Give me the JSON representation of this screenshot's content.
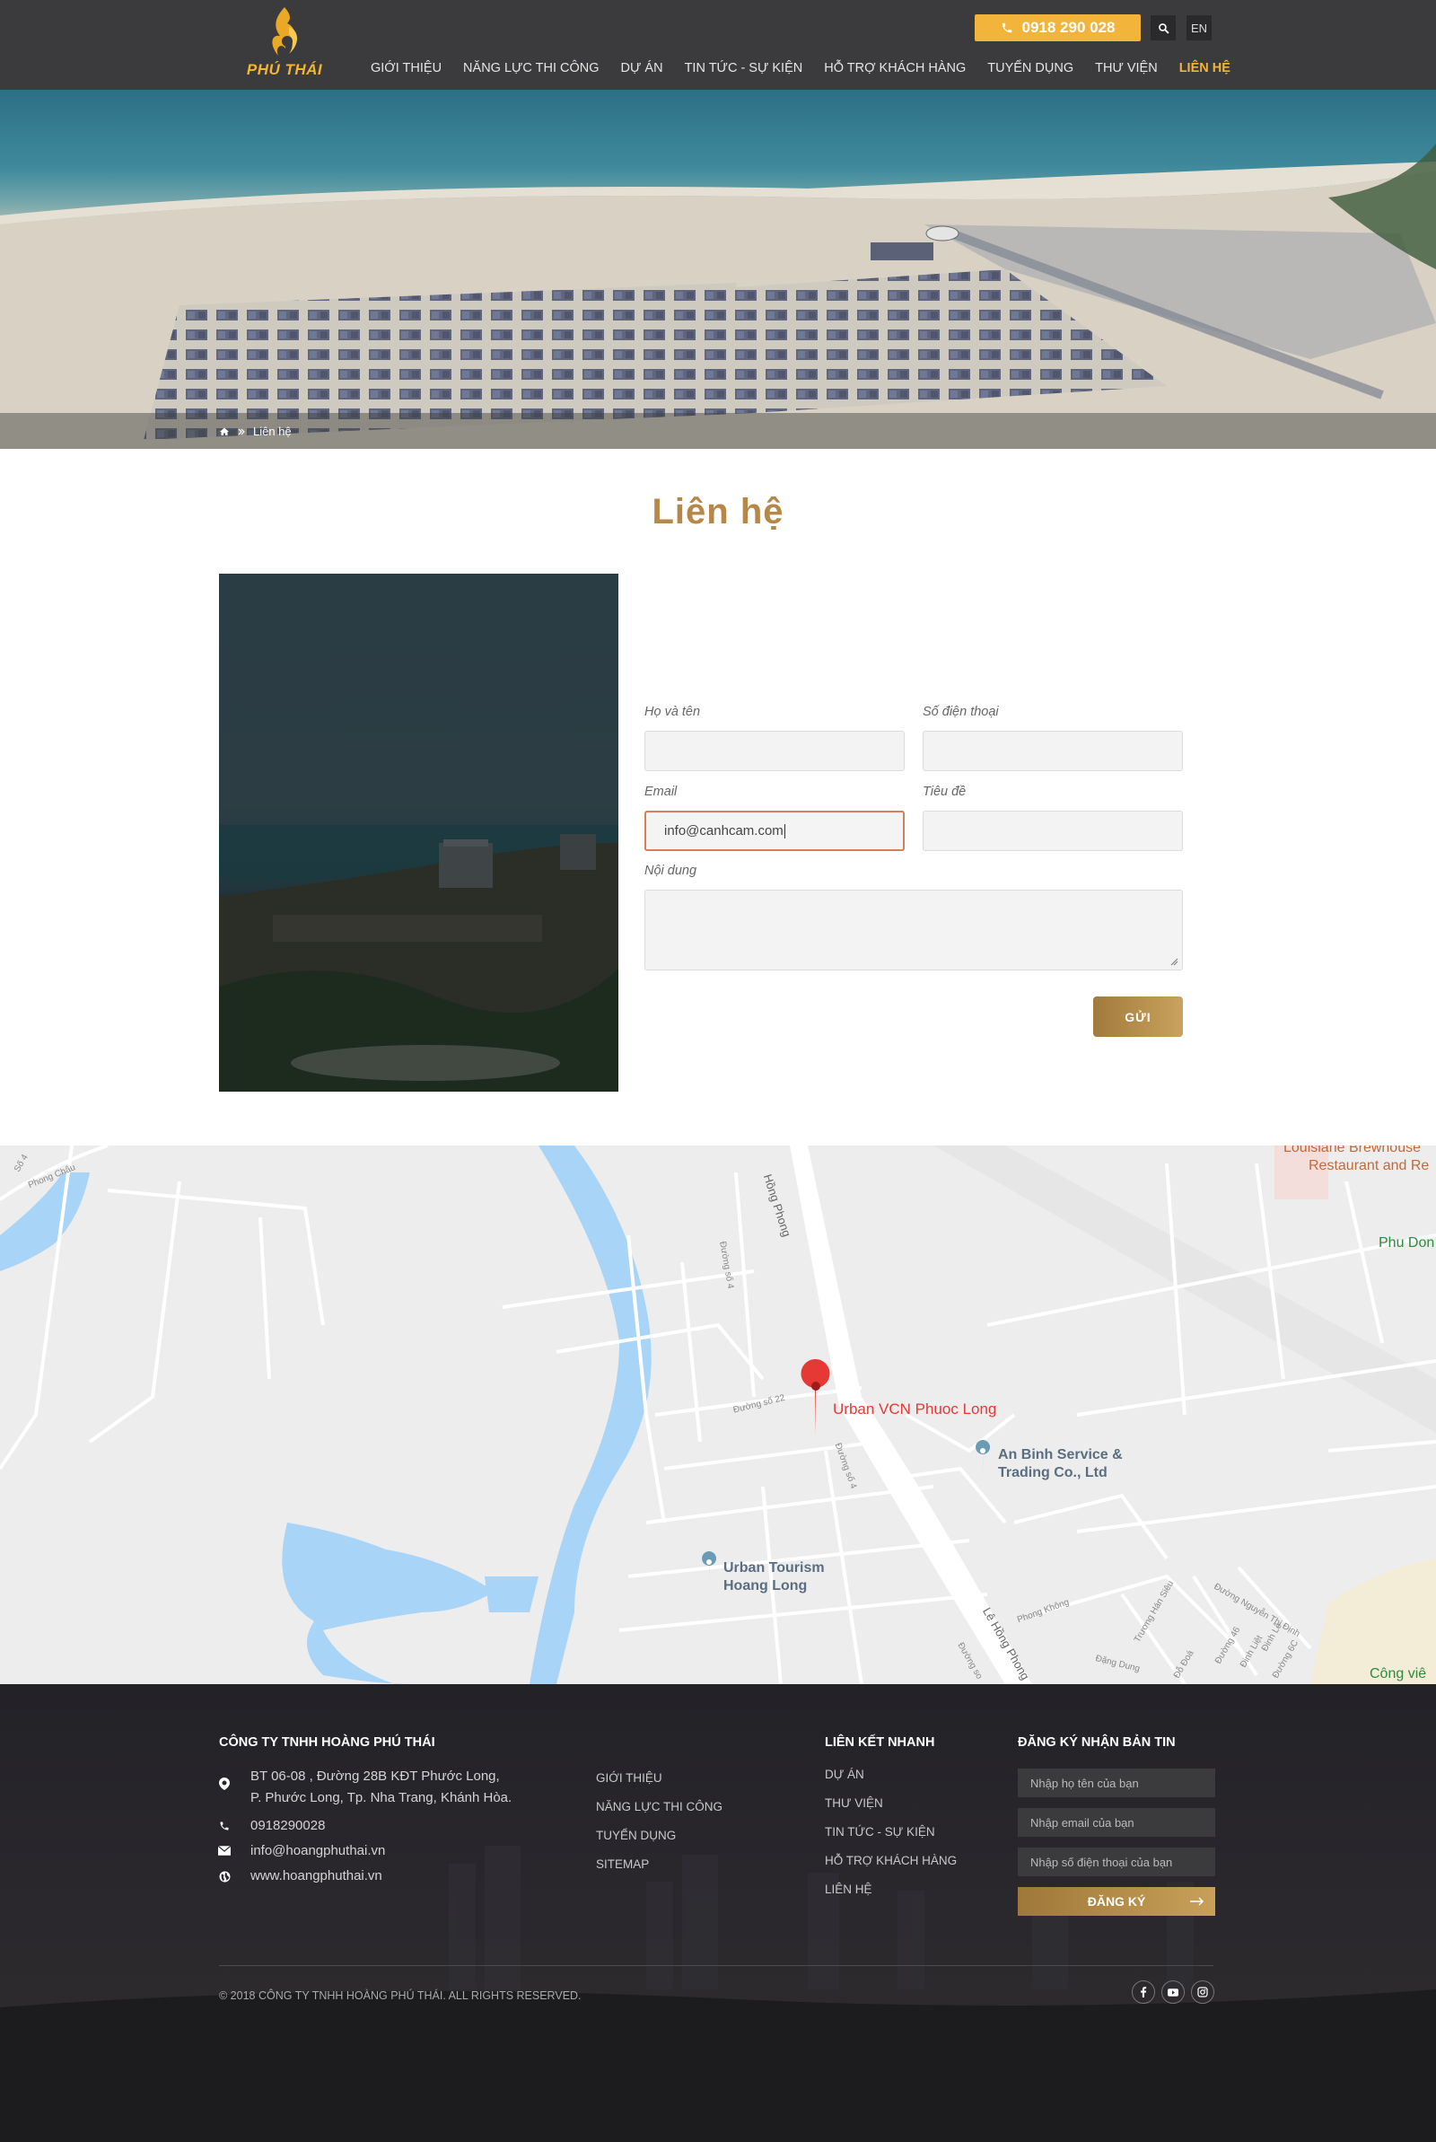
{
  "header": {
    "logo_text": "PHÚ THÁI",
    "phone": "0918 290 028",
    "lang": "EN",
    "nav": [
      {
        "label": "GIỚI THIỆU"
      },
      {
        "label": "NĂNG LỰC THI CÔNG"
      },
      {
        "label": "DỰ ÁN"
      },
      {
        "label": "TIN TỨC - SỰ KIỆN"
      },
      {
        "label": "HỖ TRỢ KHÁCH HÀNG"
      },
      {
        "label": "TUYỂN DỤNG"
      },
      {
        "label": "THƯ VIỆN"
      },
      {
        "label": "LIÊN HỆ"
      }
    ],
    "accent_color": "#f2b43b"
  },
  "breadcrumb": {
    "current": "Liên hệ"
  },
  "page": {
    "title": "Liên hệ",
    "title_color": "#b5884a"
  },
  "form": {
    "name_label": "Họ và tên",
    "phone_label": "Số điện thoại",
    "email_label": "Email",
    "email_value": "info@canhcam.com",
    "subject_label": "Tiêu đề",
    "content_label": "Nội dung",
    "submit_label": "GỬI"
  },
  "map": {
    "places": {
      "main": "Urban VCN Phuoc Long",
      "an_binh_1": "An Binh Service &",
      "an_binh_2": "Trading Co., Ltd",
      "urban_tourism_1": "Urban Tourism",
      "urban_tourism_2": "Hoang Long",
      "brewhouse_1": "Louisiane Brewhouse",
      "brewhouse_2": "Restaurant and Re",
      "phu_dong": "Phu Don",
      "cong_vien": "Công viê"
    },
    "roads": {
      "hong_phong": "Hồng Phong",
      "le_hong_phong": "Lê Hồng Phong",
      "duong_so_4a": "Đường số 4",
      "duong_so_4b": "Đường số 4",
      "duong_so_22": "Đường số 22",
      "phong_chau": "Phong Châu",
      "phong_khong": "Phong Không",
      "truong_han_sieu": "Trương Hán Siêu",
      "nguyen_thi_dinh": "Đường Nguyễn Thị Định",
      "dang_dung": "Đặng Dung",
      "dinh_liet": "Đinh Liệt",
      "duong_so_t": "Đường so",
      "so_46": "Đường 46",
      "so_6c": "Đường 6C",
      "so_la": "Đinh Lễ",
      "so_a": "Số 4",
      "doa": "Đỗ Đoá"
    },
    "water_color": "#a8d4f8",
    "marker_color": "#e53935"
  },
  "footer": {
    "company": "CÔNG TY TNHH HOÀNG PHÚ THÁI",
    "address_line1": "BT 06-08 , Đường 28B KĐT Phước Long,",
    "address_line2": "P. Phước Long, Tp. Nha Trang, Khánh Hòa.",
    "phone": "0918290028",
    "email": "info@hoangphuthai.vn",
    "website": "www.hoangphuthai.vn",
    "links_col1": [
      "GIỚI THIỆU",
      "NĂNG LỰC THI CÔNG",
      "TUYỂN DỤNG",
      "SITEMAP"
    ],
    "quick_links_title": "LIÊN KẾT NHANH",
    "links_col2": [
      "DỰ ÁN",
      "THƯ VIỆN",
      "TIN TỨC - SỰ KIỆN",
      "HỖ TRỢ KHÁCH HÀNG",
      "LIÊN HỆ"
    ],
    "newsletter_title": "ĐĂNG KÝ NHẬN BẢN TIN",
    "newsletter_name_placeholder": "Nhập họ tên của bạn",
    "newsletter_email_placeholder": "Nhập email của bạn",
    "newsletter_phone_placeholder": "Nhập số điện thoại của bạn",
    "subscribe_label": "ĐĂNG KÝ",
    "copyright": "© 2018 CÔNG TY TNHH HOÀNG PHÚ THÁI. ALL RIGHTS RESERVED."
  }
}
